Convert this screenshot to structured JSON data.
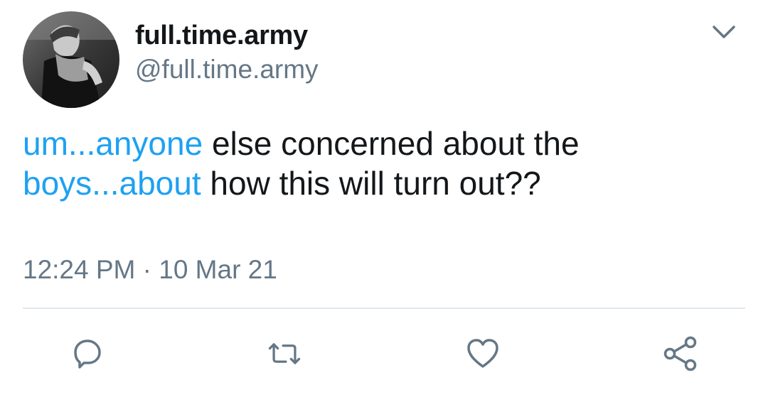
{
  "user": {
    "display_name": "full.time.army",
    "handle": "@full.time.army",
    "avatar_icon": "profile-photo"
  },
  "tweet": {
    "lines": [
      {
        "link": "um...anyone",
        "text": " else concerned about the"
      },
      {
        "link": "boys...about",
        "text": " how this will turn out??"
      }
    ],
    "timestamp": "12:24 PM · 10 Mar 21"
  },
  "actions": {
    "reply_icon": "reply-icon",
    "retweet_icon": "retweet-icon",
    "like_icon": "heart-icon",
    "share_icon": "share-icon"
  },
  "colors": {
    "text": "#14171a",
    "secondary": "#657786",
    "link": "#1da1f2",
    "divider": "#e1e8ed"
  }
}
